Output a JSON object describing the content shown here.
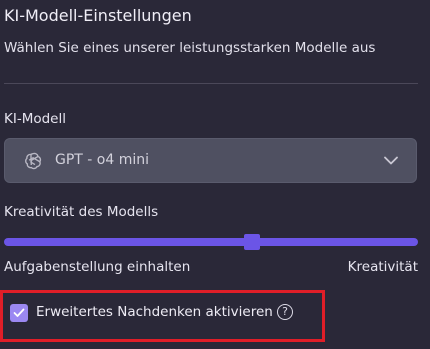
{
  "header": {
    "title": "KI-Modell-Einstellungen",
    "subtitle": "Wählen Sie eines unserer leistungsstarken Modelle aus"
  },
  "model": {
    "label": "KI-Modell",
    "selected": "GPT - o4 mini",
    "icon": "openai-icon"
  },
  "creativity": {
    "label": "Kreativität des Modells",
    "min_label": "Aufgabenstellung einhalten",
    "max_label": "Kreativität",
    "value_fraction": 0.6
  },
  "advanced": {
    "label": "Erweitertes Nachdenken aktivieren",
    "checked": true,
    "help_glyph": "?"
  },
  "colors": {
    "background": "#2a2838",
    "accent": "#6b55e6",
    "checkbox": "#9b88f2",
    "highlight": "#e01e28"
  }
}
